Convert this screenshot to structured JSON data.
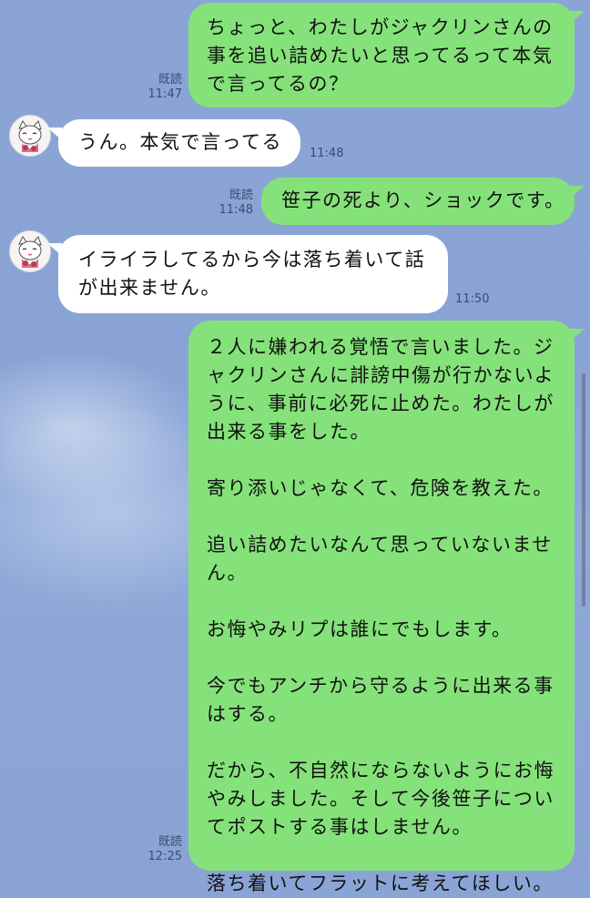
{
  "messages": [
    {
      "side": "out",
      "read_label": "既読",
      "time": "11:47",
      "text": "ちょっと、わたしがジャクリンさんの\n事を追い詰めたいと思ってるって本気\nで言ってるの？"
    },
    {
      "side": "in",
      "avatar": "cat-avatar-icon",
      "time": "11:48",
      "text": "うん。本気で言ってる"
    },
    {
      "side": "out",
      "read_label": "既読",
      "time": "11:48",
      "text": "笹子の死より、ショックです。"
    },
    {
      "side": "in",
      "avatar": "cat-avatar-icon",
      "time": "11:50",
      "text": "イライラしてるから今は落ち着いて話\nが出来ません。"
    },
    {
      "side": "out",
      "read_label": "既読",
      "time": "12:25",
      "text": "２人に嫌われる覚悟で言いました。ジ\nャクリンさんに誹謗中傷が行かないよ\nうに、事前に必死に止めた。わたしが\n出来る事をした。\n\n寄り添いじゃなくて、危険を教えた。\n\n追い詰めたいなんて思っていないませ\nん。\n\nお悔やみリプは誰にでもします。\n\n今でもアンチから守るように出来る事\nはする。\n\nだから、不自然にならないようにお悔\nやみしました。そして今後笹子につい\nてポストする事はしません。\n\n落ち着いてフラットに考えてほしい。"
    }
  ],
  "colors": {
    "background": "#8aa4d6",
    "outgoing_bubble": "#85e27a",
    "incoming_bubble": "#ffffff"
  }
}
